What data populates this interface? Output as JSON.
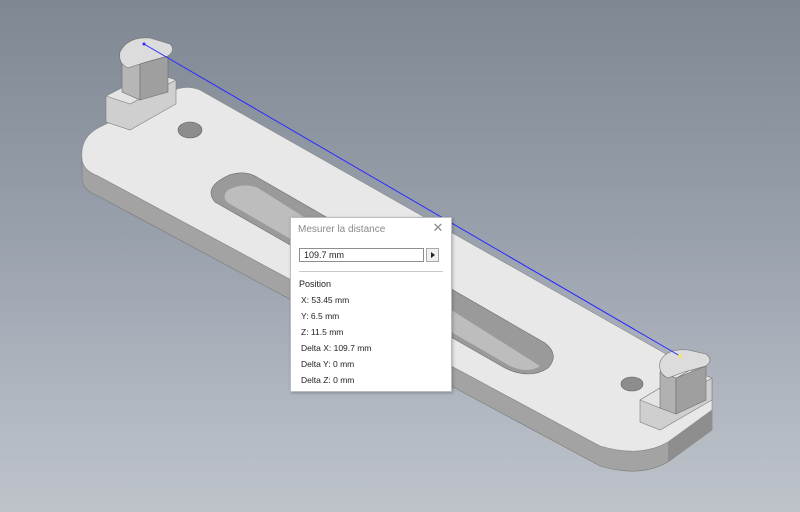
{
  "dialog": {
    "title": "Mesurer la distance",
    "close_icon": "close-icon",
    "distance_value": "109.7 mm",
    "expand_icon": "triangle-right-icon",
    "section_label": "Position",
    "rows": [
      "X: 53.45 mm",
      "Y: 6.5 mm",
      "Z: 11.5 mm",
      "Delta X: 109.7 mm",
      "Delta Y: 0 mm",
      "Delta Z: 0 mm"
    ]
  },
  "colors": {
    "background_top": "#7f8793",
    "background_bottom": "#bec3ca",
    "measure_line": "#2b2bff",
    "part_top": "#e9e9e9",
    "part_side": "#a6a6a6"
  }
}
